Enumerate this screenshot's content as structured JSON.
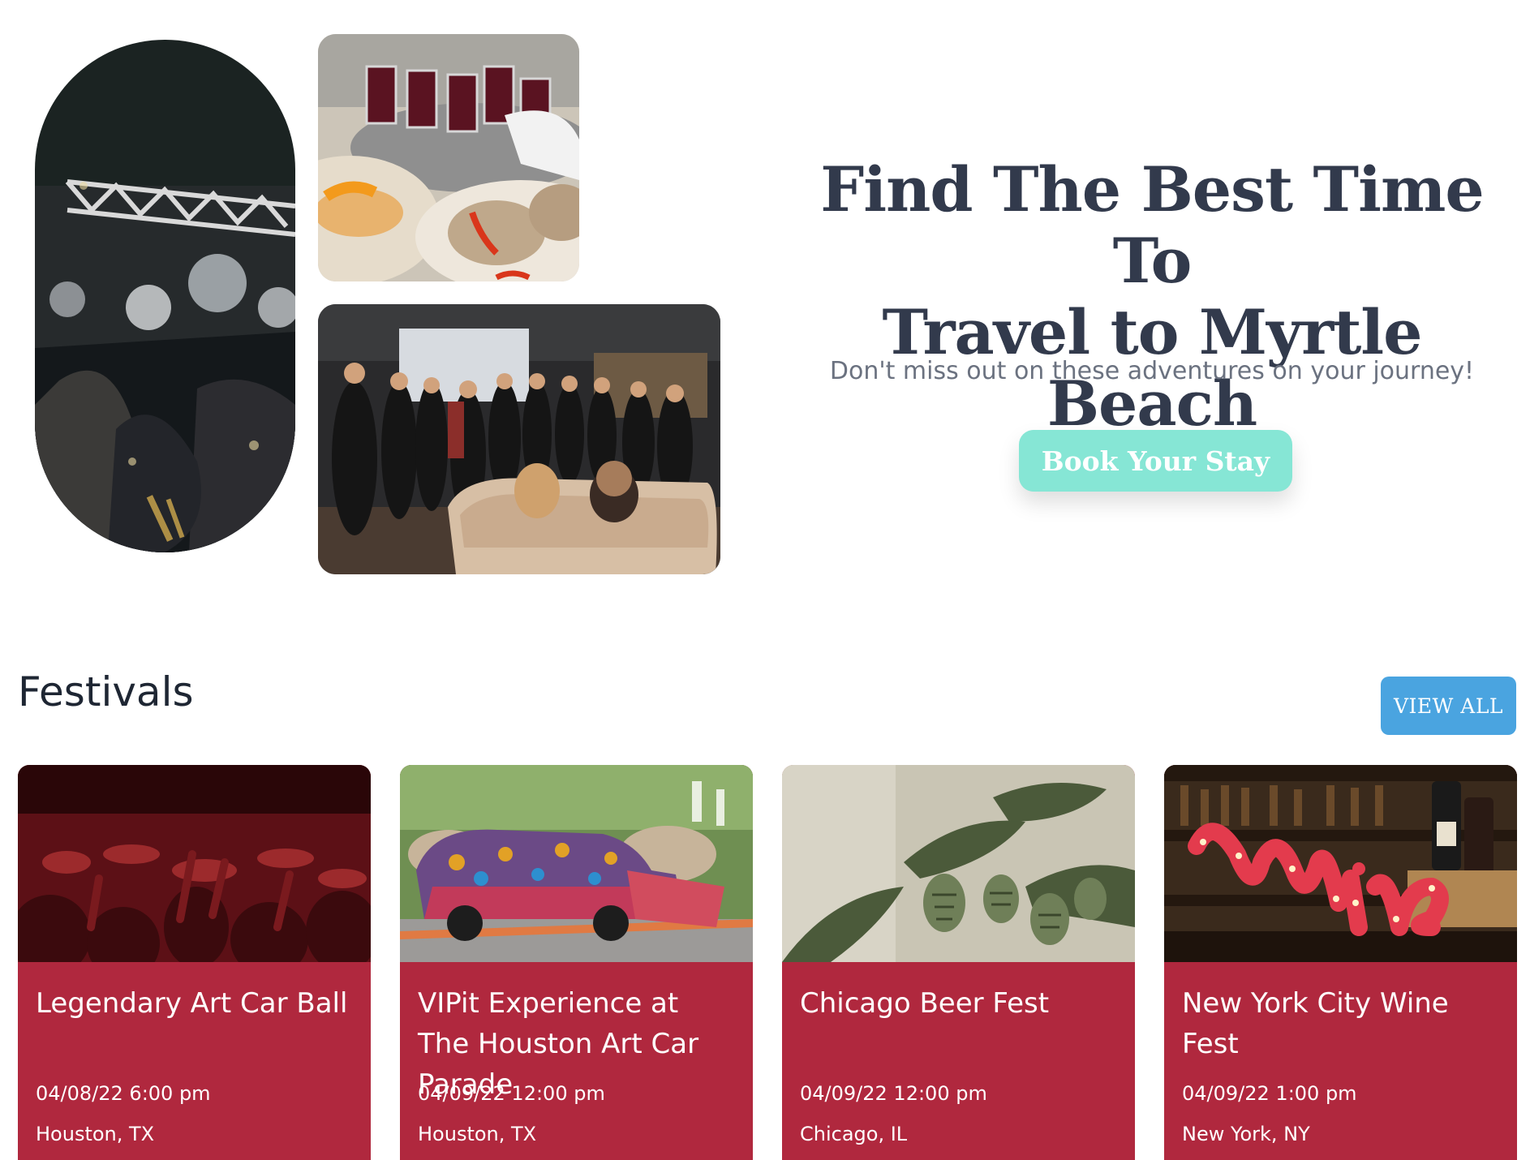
{
  "hero": {
    "title_line1": "Find The Best Time To",
    "title_line2": "Travel to Myrtle Beach",
    "subtitle": "Don't miss out on these adventures on your journey!",
    "book_button": "Book Your Stay"
  },
  "festivals": {
    "heading": "Festivals",
    "view_all": "VIEW ALL",
    "cards": [
      {
        "title": "Legendary Art Car Ball",
        "date": "04/08/22 6:00 pm",
        "location": "Houston, TX"
      },
      {
        "title": "VIPit Experience at The Houston Art Car Parade",
        "date": "04/09/22 12:00 pm",
        "location": "Houston, TX"
      },
      {
        "title": "Chicago Beer Fest",
        "date": "04/09/22 12:00 pm",
        "location": "Chicago, IL"
      },
      {
        "title": "New York City Wine Fest",
        "date": "04/09/22 1:00 pm",
        "location": "New York, NY"
      }
    ]
  },
  "colors": {
    "card_bg": "#b0283e",
    "book_button": "#86e6d5",
    "view_all_button": "#4aa4e0",
    "title_text": "#323a4c"
  }
}
